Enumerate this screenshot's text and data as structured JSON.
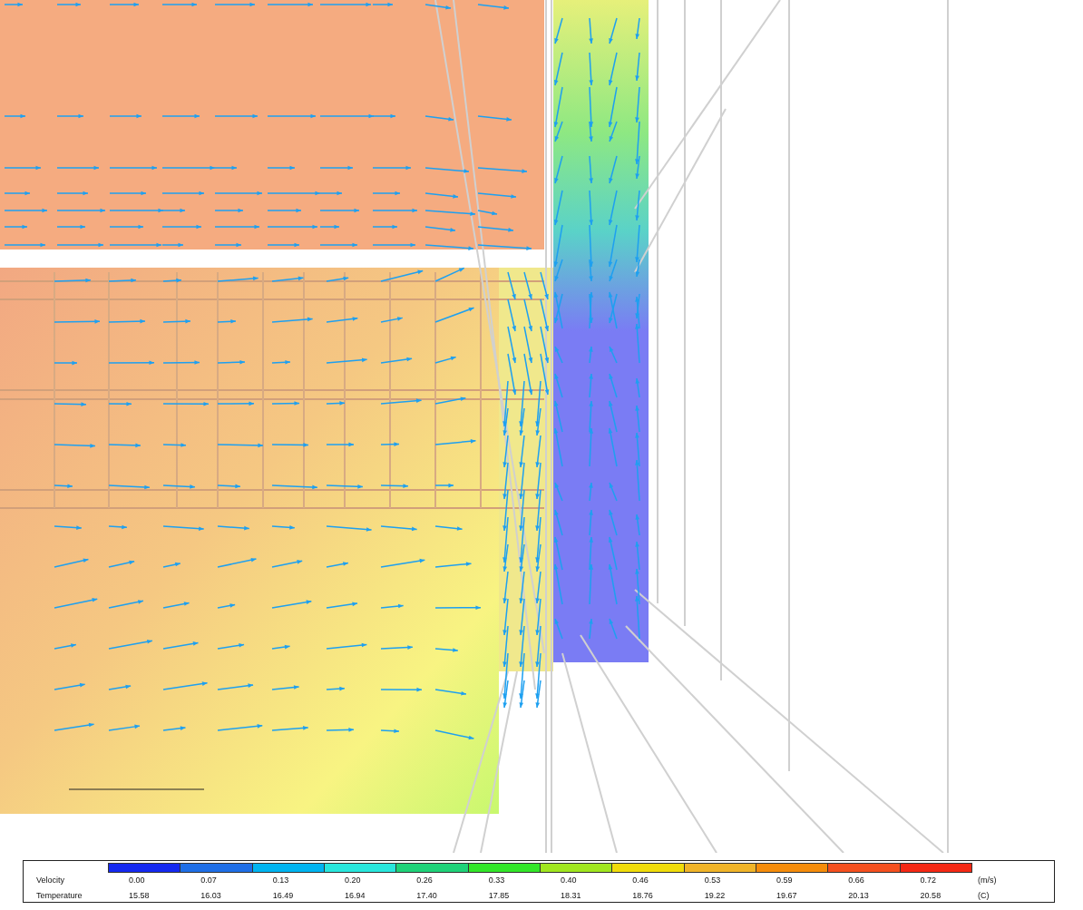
{
  "legend": {
    "rows": [
      {
        "label": "Velocity",
        "unit": "(m/s)"
      },
      {
        "label": "Temperature",
        "unit": "(C)"
      }
    ],
    "swatches": [
      {
        "color": "#1428f0",
        "velocity": "0.00",
        "temperature": "15.58"
      },
      {
        "color": "#1e6ee6",
        "velocity": "0.07",
        "temperature": "16.03"
      },
      {
        "color": "#00b4f0",
        "velocity": "0.13",
        "temperature": "16.49"
      },
      {
        "color": "#28e6dc",
        "velocity": "0.20",
        "temperature": "16.94"
      },
      {
        "color": "#1ed278",
        "velocity": "0.26",
        "temperature": "17.40"
      },
      {
        "color": "#32e628",
        "velocity": "0.33",
        "temperature": "17.85"
      },
      {
        "color": "#a0e61e",
        "velocity": "0.40",
        "temperature": "18.31"
      },
      {
        "color": "#f0dc0a",
        "velocity": "0.46",
        "temperature": "18.76"
      },
      {
        "color": "#f0b428",
        "velocity": "0.53",
        "temperature": "19.22"
      },
      {
        "color": "#f58c0a",
        "velocity": "0.59",
        "temperature": "19.67"
      },
      {
        "color": "#f5501e",
        "velocity": "0.66",
        "temperature": "20.13"
      },
      {
        "color": "#f52814",
        "velocity": "0.72",
        "temperature": "20.58"
      }
    ]
  }
}
